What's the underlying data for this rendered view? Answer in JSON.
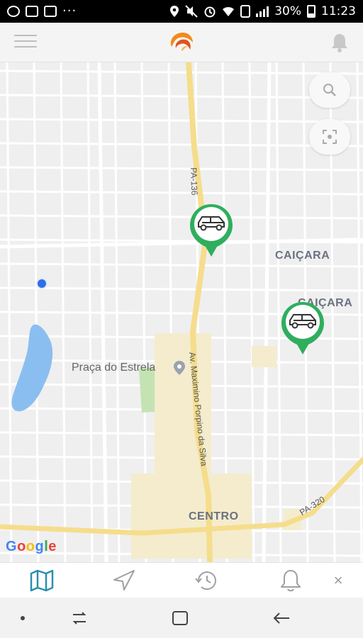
{
  "status_bar": {
    "left_icons": [
      "whatsapp-icon",
      "gallery-icon",
      "cast-icon"
    ],
    "more": "···",
    "right_icons": [
      "location-icon",
      "mute-icon",
      "alarm-icon",
      "wifi-icon",
      "nfc-icon",
      "signal-icon"
    ],
    "battery": "30%",
    "time": "11:23"
  },
  "header": {
    "menu_icon": "hamburger-menu-icon",
    "logo": "app-logo",
    "notification_icon": "bell-icon"
  },
  "map": {
    "labels": {
      "caicara_1": "CAIÇARA",
      "caicara_2": "CAIÇARA",
      "centro": "CENTRO",
      "poi": "Praça do Estrela",
      "road_pa136": "PA-136",
      "road_pa320": "PA-320",
      "avenue": "Av. Maximino Porpino da Silva"
    },
    "controls": [
      "zoom-icon",
      "fit-bounds-icon"
    ],
    "attribution": [
      "G",
      "o",
      "o",
      "g",
      "l",
      "e"
    ],
    "vehicle_markers": 2
  },
  "tabs": [
    {
      "name": "map",
      "icon": "map-icon",
      "active": true
    },
    {
      "name": "navigate",
      "icon": "navigation-arrow-icon",
      "active": false
    },
    {
      "name": "history",
      "icon": "history-clock-icon",
      "active": false
    },
    {
      "name": "alerts",
      "icon": "bell-icon",
      "active": false
    }
  ],
  "tab_close": "×",
  "colors": {
    "accent": "#2a8fb0",
    "marker": "#2fae5e",
    "main_road": "#f5dd8c",
    "water": "#8bbef0",
    "park": "#c4e3b2"
  }
}
